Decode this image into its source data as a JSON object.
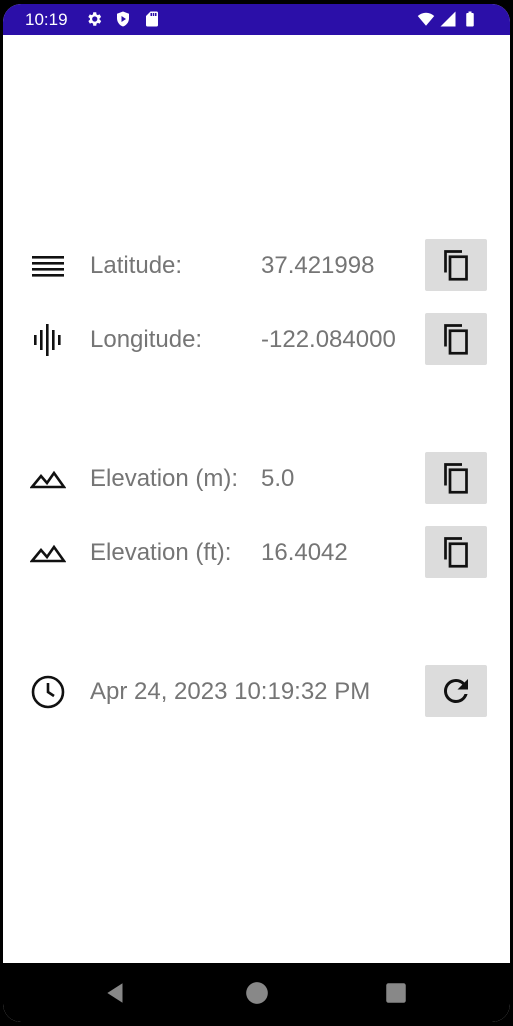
{
  "status_bar": {
    "time": "10:19",
    "icons": [
      "settings-icon",
      "shield-play-icon",
      "sd-card-icon",
      "wifi-icon",
      "signal-icon",
      "battery-icon"
    ],
    "color": "#2b0fa8"
  },
  "coords": {
    "latitude": {
      "label": "Latitude:",
      "value": "37.421998",
      "icon": "latitude-lines-icon"
    },
    "longitude": {
      "label": "Longitude:",
      "value": "-122.084000",
      "icon": "longitude-lines-icon"
    }
  },
  "elevation": {
    "meters": {
      "label": "Elevation (m):",
      "value": "5.0",
      "icon": "mountain-icon"
    },
    "feet": {
      "label": "Elevation (ft):",
      "value": "16.4042",
      "icon": "mountain-icon"
    }
  },
  "timestamp": {
    "value": "Apr 24, 2023 10:19:32 PM",
    "icon": "clock-icon"
  },
  "buttons": {
    "copy_icon": "copy-icon",
    "refresh_icon": "refresh-icon",
    "background": "#dcdcdc"
  },
  "nav_bar": {
    "items": [
      "back-icon",
      "home-icon",
      "recents-icon"
    ]
  }
}
